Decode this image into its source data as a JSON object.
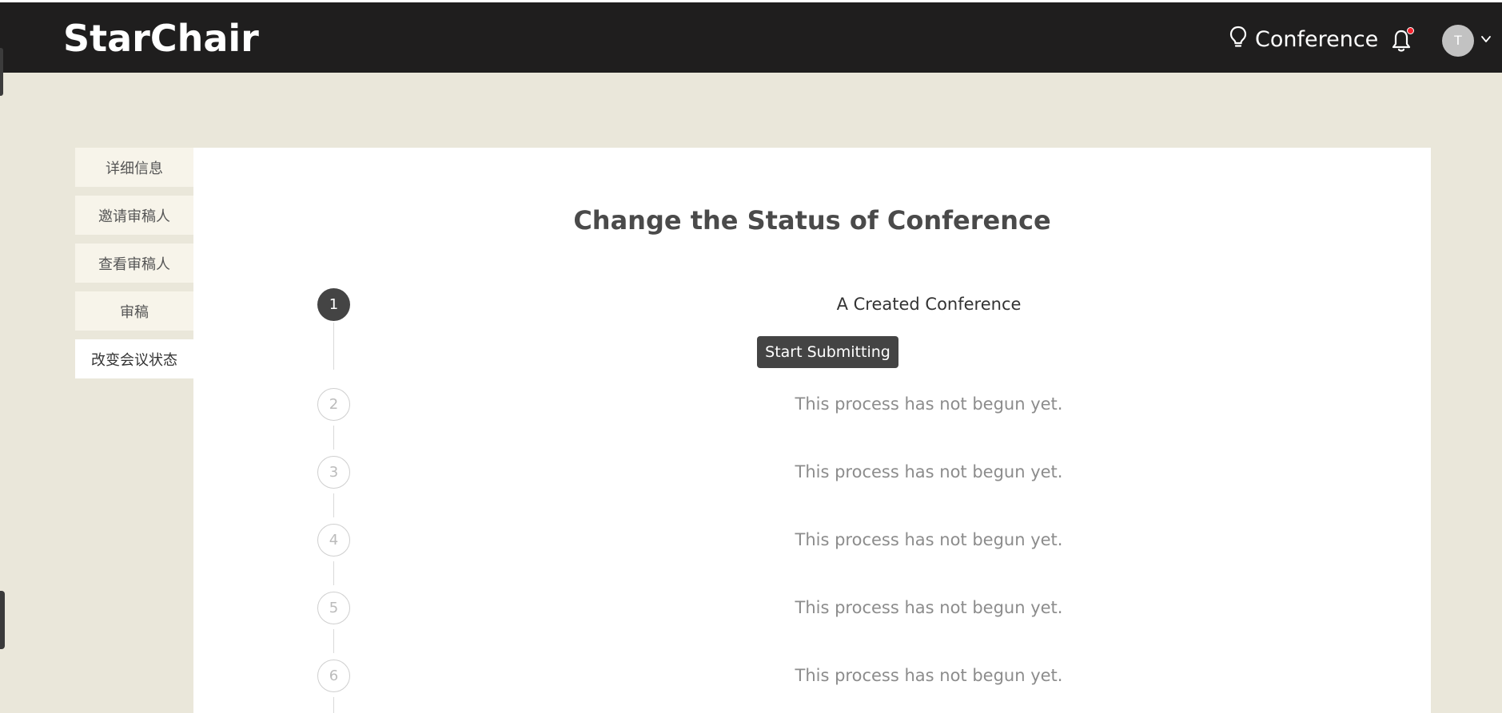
{
  "app": {
    "logo": "StarChair",
    "nav_conference": "Conference",
    "avatar_initial": "T"
  },
  "icons": {
    "nav_conference": "lightbulb-icon",
    "notifications": "bell-icon",
    "user_menu": "chevron-down-icon"
  },
  "colors": {
    "topbar": "#1f1e1e",
    "background": "#eae7da",
    "notification_dot": "#f5222d",
    "active_step": "#444444"
  },
  "sidebar": {
    "items": [
      {
        "label": "详细信息"
      },
      {
        "label": "邀请审稿人"
      },
      {
        "label": "查看审稿人"
      },
      {
        "label": "审稿"
      },
      {
        "label": "改变会议状态",
        "active": true
      }
    ]
  },
  "main": {
    "title": "Change the Status of Conference",
    "steps": [
      {
        "number": "1",
        "status": "current",
        "text": "A Created Conference",
        "button": "Start Submitting"
      },
      {
        "number": "2",
        "status": "pending",
        "text": "This process has not begun yet."
      },
      {
        "number": "3",
        "status": "pending",
        "text": "This process has not begun yet."
      },
      {
        "number": "4",
        "status": "pending",
        "text": "This process has not begun yet."
      },
      {
        "number": "5",
        "status": "pending",
        "text": "This process has not begun yet."
      },
      {
        "number": "6",
        "status": "pending",
        "text": "This process has not begun yet."
      }
    ]
  }
}
